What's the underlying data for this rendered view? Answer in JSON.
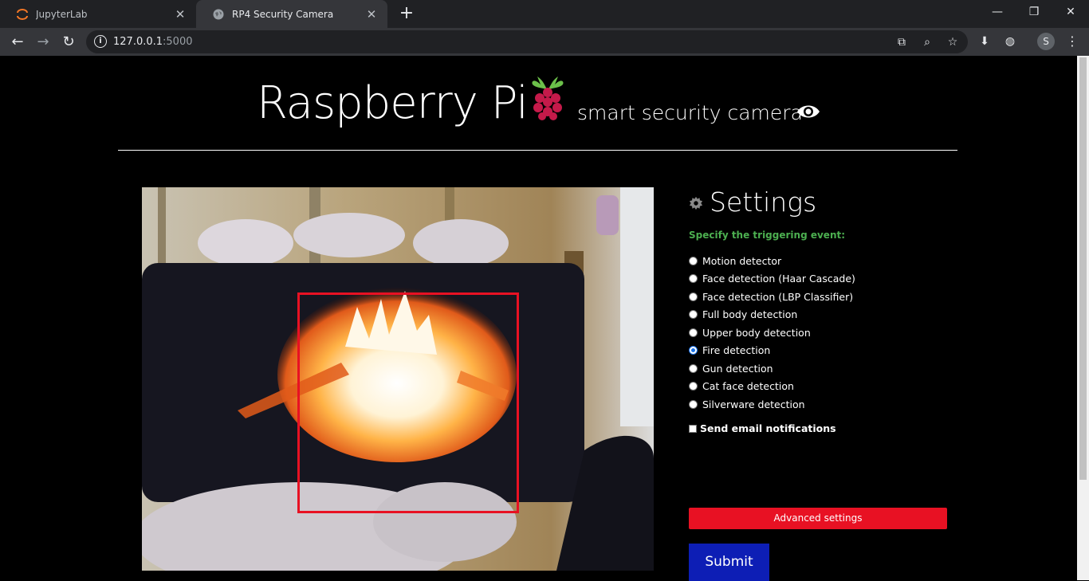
{
  "browser": {
    "tabs": [
      {
        "title": "JupyterLab",
        "active": false
      },
      {
        "title": "RP4 Security Camera",
        "active": true
      }
    ],
    "url_host": "127.0.0.1",
    "url_port": ":5000",
    "profile_initial": "S"
  },
  "header": {
    "title": "Raspberry Pi",
    "subtitle": "smart security camera"
  },
  "settings": {
    "title": "Settings",
    "prompt": "Specify the triggering event:",
    "options": [
      {
        "label": "Motion detector",
        "checked": false
      },
      {
        "label": "Face detection (Haar Cascade)",
        "checked": false
      },
      {
        "label": "Face detection (LBP Classifier)",
        "checked": false
      },
      {
        "label": "Full body detection",
        "checked": false
      },
      {
        "label": "Upper body detection",
        "checked": false
      },
      {
        "label": "Fire detection",
        "checked": true
      },
      {
        "label": "Gun detection",
        "checked": false
      },
      {
        "label": "Cat face detection",
        "checked": false
      },
      {
        "label": "Silverware detection",
        "checked": false
      }
    ],
    "email_label": "Send email notifications",
    "email_checked": false,
    "advanced_label": "Advanced settings",
    "submit_label": "Submit"
  },
  "colors": {
    "accent_green": "#4caf50",
    "advanced_red": "#e81123",
    "submit_blue": "#0d1eb5",
    "detection_box": "#e81123"
  }
}
